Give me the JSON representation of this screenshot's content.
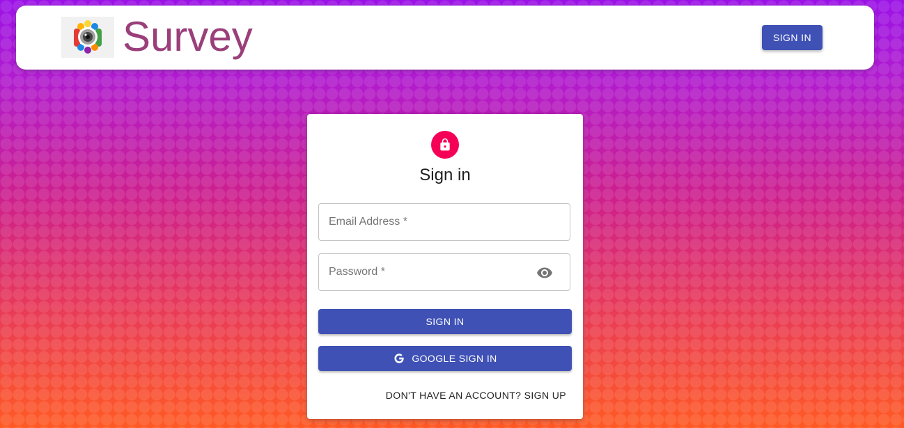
{
  "header": {
    "brand_title": "Survey",
    "logo_icon": "camera-lens-logo-icon",
    "signin_label": "SIGN IN"
  },
  "card": {
    "avatar_icon": "lock-icon",
    "title": "Sign in",
    "email": {
      "placeholder": "Email Address *",
      "value": ""
    },
    "password": {
      "placeholder": "Password *",
      "value": "",
      "toggle_icon": "eye-icon"
    },
    "signin_label": "SIGN IN",
    "google_label": "GOOGLE SIGN IN",
    "google_icon": "google-g-icon",
    "signup_link": "DON'T HAVE AN ACCOUNT? SIGN UP"
  },
  "colors": {
    "primary": "#3f51b5",
    "avatar": "#f50057",
    "brand_text": "#9a3f7a",
    "background_top": "#9b12e6",
    "background_bottom": "#ff5a24"
  }
}
